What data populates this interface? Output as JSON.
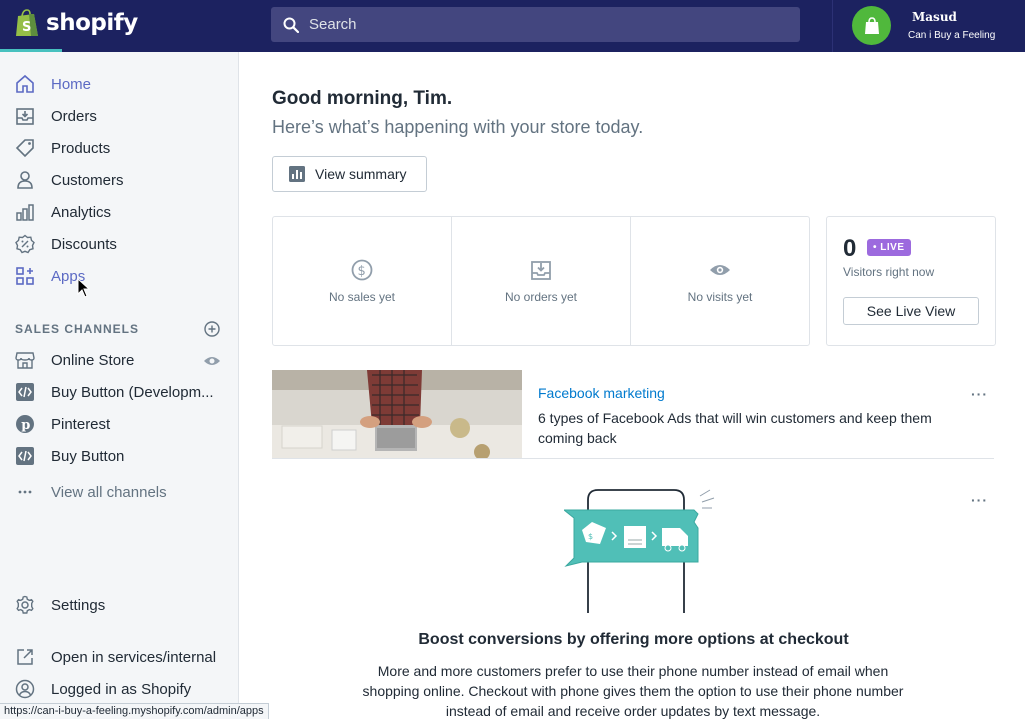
{
  "brand": {
    "name": "shopify",
    "accent": "#47c1bf",
    "topbar_color": "#1c2260"
  },
  "search": {
    "placeholder": "Search"
  },
  "user": {
    "name": "Masud",
    "store": "Can i Buy a Feeling"
  },
  "nav": {
    "home": "Home",
    "orders": "Orders",
    "products": "Products",
    "customers": "Customers",
    "analytics": "Analytics",
    "discounts": "Discounts",
    "apps": "Apps"
  },
  "sales_channels": {
    "heading": "SALES CHANNELS",
    "items": [
      "Online Store",
      "Buy Button (Developm...",
      "Pinterest",
      "Buy Button"
    ],
    "view_all": "View all channels"
  },
  "footer_nav": {
    "settings": "Settings",
    "open_internal": "Open in services/internal",
    "logged_in": "Logged in as Shopify"
  },
  "status_url": "https://can-i-buy-a-feeling.myshopify.com/admin/apps",
  "main": {
    "greeting": "Good morning, Tim.",
    "subtitle": "Here’s what’s happening with your store today.",
    "view_summary": "View summary",
    "stats": [
      "No sales yet",
      "No orders yet",
      "No visits yet"
    ],
    "live": {
      "count": "0",
      "badge": "• LIVE",
      "label": "Visitors right now",
      "button": "See Live View"
    },
    "fb_card": {
      "title": "Facebook marketing",
      "desc": "6 types of Facebook Ads that will win customers and keep them coming back"
    },
    "boost": {
      "title": "Boost conversions by offering more options at checkout",
      "body": "More and more customers prefer to use their phone number instead of email when shopping online. Checkout with phone gives them the option to use their phone number instead of email and receive order updates by text message."
    },
    "more_dots": "···"
  }
}
